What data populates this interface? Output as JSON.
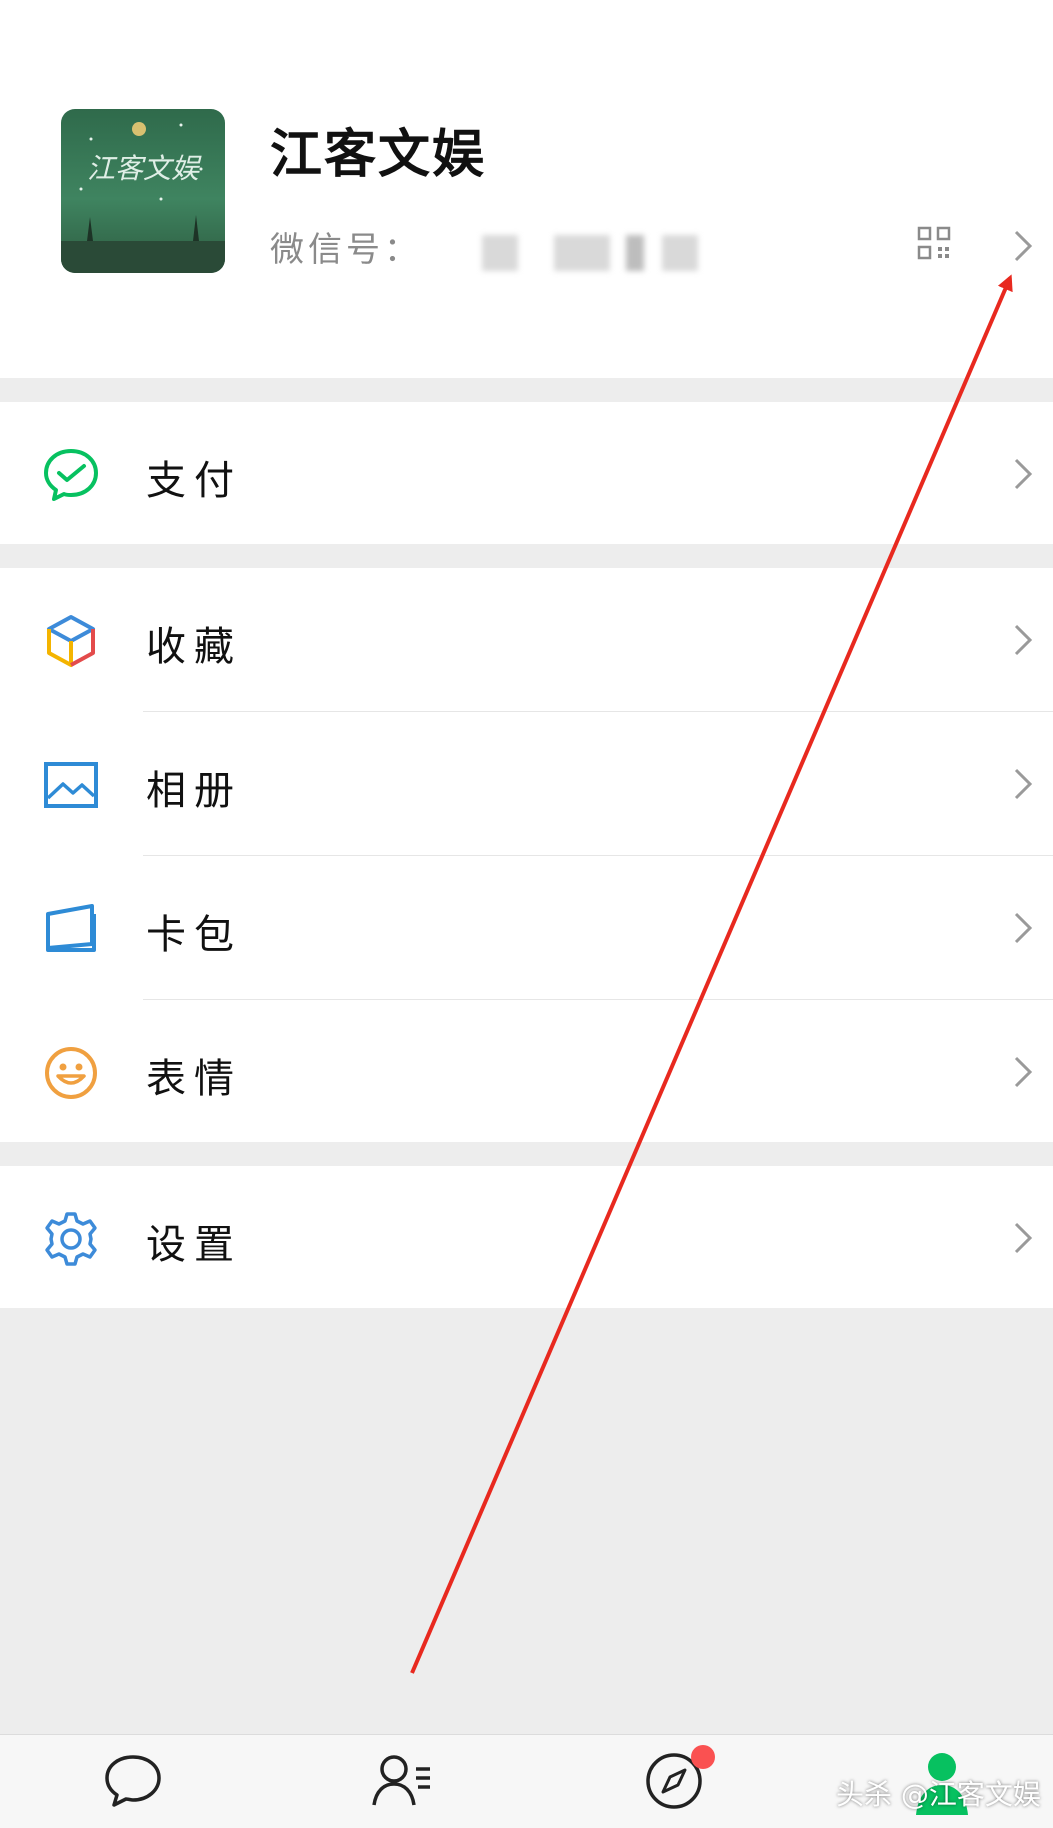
{
  "profile": {
    "name": "江客文娱",
    "wechat_id_label": "微信号：",
    "avatar_text": "江客文娱"
  },
  "menu": {
    "pay": {
      "label": "支付",
      "icon": "wechat-pay-icon"
    },
    "favorites": {
      "label": "收藏",
      "icon": "cube-icon"
    },
    "album": {
      "label": "相册",
      "icon": "image-icon"
    },
    "cards": {
      "label": "卡包",
      "icon": "card-wallet-icon"
    },
    "stickers": {
      "label": "表情",
      "icon": "smile-icon"
    },
    "settings": {
      "label": "设置",
      "icon": "gear-icon"
    }
  },
  "tabbar": {
    "items": [
      "chat-bubble-icon",
      "contacts-icon",
      "compass-icon",
      "me-icon"
    ]
  },
  "watermark": "头杀 @江客文娱",
  "colors": {
    "accent_green": "#07c160",
    "favorites_colors": [
      "#f4b400",
      "#e34b4b",
      "#3d8bd9"
    ],
    "album_blue": "#2e8bd6",
    "sticker_orange": "#f0a040",
    "settings_blue": "#3d8bd9",
    "annotation_arrow": "#e8291f",
    "badge_red": "#fa5151"
  }
}
